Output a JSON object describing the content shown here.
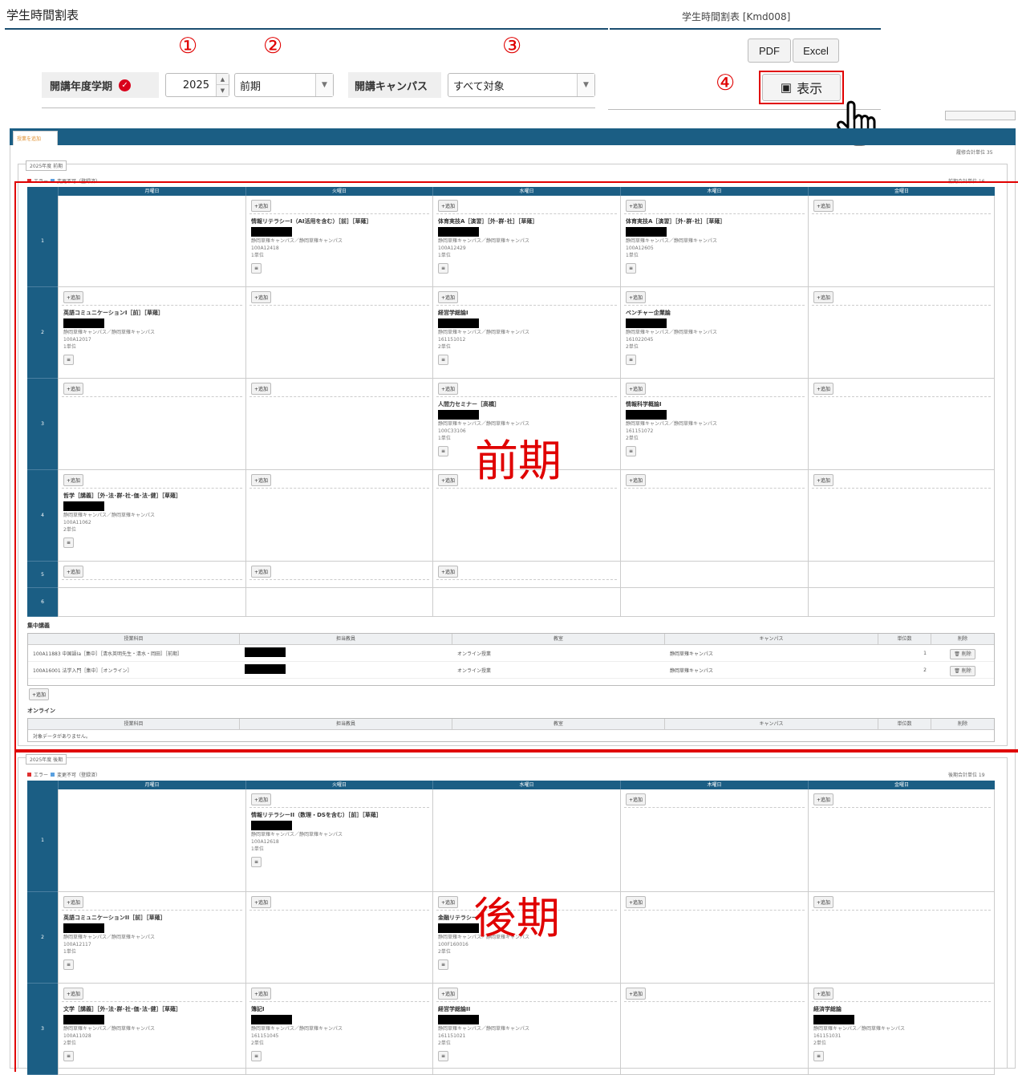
{
  "header": {
    "title": "学生時間割表",
    "screen_id": "学生時間割表 [Kmd008]",
    "pdf_label": "PDF",
    "excel_label": "Excel",
    "show_label": "表示"
  },
  "annotations": {
    "num1": "①",
    "num2": "②",
    "num3": "③",
    "num4": "④",
    "term1": "前期",
    "term2": "後期"
  },
  "filters": {
    "year_term_label": "開講年度学期",
    "year_value": "2025",
    "term_value": "前期",
    "campus_label": "開講キャンパス",
    "campus_value": "すべて対象"
  },
  "colors": {
    "accent": "#1b5e84",
    "annotation_red": "#e00000",
    "required_badge": "#d9001b"
  },
  "icons": {
    "required": "check-circle-icon",
    "show": "binoculars-icon",
    "pointer": "hand-pointer-icon"
  },
  "timetable": {
    "periods": [
      "1",
      "2",
      "3",
      "4",
      "5",
      "6"
    ],
    "add_label": "+追加",
    "spring": {
      "cells": [
        {
          "row": 0,
          "col": 1,
          "title": "情報リテラシーI（AI活用を含む）［前］［草薙］",
          "meta": "100A12418",
          "credits": "1単位"
        },
        {
          "row": 0,
          "col": 2,
          "title": "体育実技A［演習］［外･群･社］［草薙］",
          "meta": "100A12429",
          "credits": "1単位"
        },
        {
          "row": 0,
          "col": 3,
          "title": "体育実技A［演習］［外･群･社］［草薙］",
          "meta": "100A12605",
          "credits": "1単位"
        },
        {
          "row": 1,
          "col": 0,
          "title": "英語コミュニケーションI［前］［草薙］",
          "meta": "100A12017",
          "credits": "1単位"
        },
        {
          "row": 1,
          "col": 2,
          "title": "経営学総論I",
          "meta": "161151012",
          "credits": "2単位"
        },
        {
          "row": 1,
          "col": 3,
          "title": "ベンチャー企業論",
          "meta": "161022045",
          "credits": "2単位"
        },
        {
          "row": 2,
          "col": 2,
          "title": "人間力セミナー［高橋］",
          "meta": "100C33106",
          "credits": "1単位"
        },
        {
          "row": 2,
          "col": 3,
          "title": "情報科学概論I",
          "meta": "161151072",
          "credits": "2単位"
        },
        {
          "row": 3,
          "col": 0,
          "title": "哲学［講義］［外･法･群･社･価･法･健］［草薙］",
          "meta": "100A11062",
          "credits": "2単位"
        }
      ]
    },
    "fall": {
      "cells": [
        {
          "row": 0,
          "col": 1,
          "title": "情報リテラシーII（数理・DSを含む）［前］［草薙］",
          "meta": "100A12618",
          "credits": "1単位"
        },
        {
          "row": 1,
          "col": 0,
          "title": "英語コミュニケーションII［前］［草薙］",
          "meta": "100A12117",
          "credits": "1単位"
        },
        {
          "row": 1,
          "col": 2,
          "title": "金融リテラシー",
          "meta": "100F160016",
          "credits": "2単位"
        },
        {
          "row": 2,
          "col": 0,
          "title": "文学［講義］［外･法･群･社･価･法･健］［草薙］",
          "meta": "100A11028",
          "credits": "2単位"
        },
        {
          "row": 2,
          "col": 1,
          "title": "簿記I",
          "meta": "161151045",
          "credits": "2単位"
        },
        {
          "row": 2,
          "col": 2,
          "title": "経営学総論II",
          "meta": "161151021",
          "credits": "2単位"
        },
        {
          "row": 2,
          "col": 4,
          "title": "経済学総論",
          "meta": "161151031",
          "credits": "2単位"
        }
      ]
    }
  },
  "intensive": {
    "heading": "集中講義",
    "rows": [
      {
        "course": "100A11883 中国語Ia［集中］［清水英明先生・清水・岡田］［前期］",
        "room": "オンライン授業",
        "campus": "静岡草薙キャンパス",
        "credits": "1",
        "action": "削除"
      },
      {
        "course": "100A16001 法学入門［集中］［オンライン］",
        "room": "オンライン授業",
        "campus": "静岡草薙キャンパス",
        "credits": "2",
        "action": "削除"
      }
    ],
    "add_label": "+追加"
  },
  "online": {
    "heading": "オンライン",
    "empty_text": "対象データがありません。"
  }
}
